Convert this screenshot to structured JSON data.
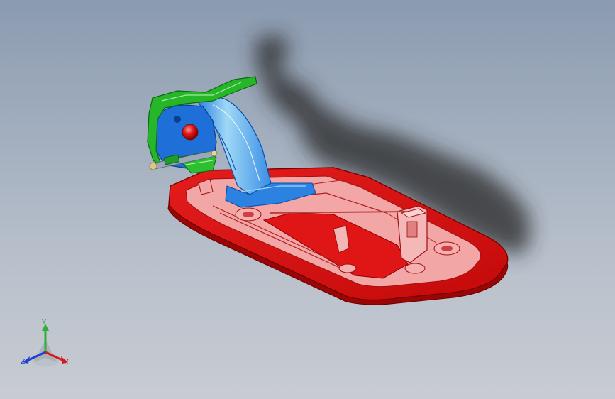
{
  "viewport": {
    "background_top": "#8b9bb0",
    "background_bottom": "#c8ccd2"
  },
  "model": {
    "colors": {
      "base_plate": "#e0141a",
      "base_plate_edge": "#8a0000",
      "base_highlight": "#f0a0a0",
      "bracket": "#7ec8f0",
      "bracket_dark": "#1e6fd8",
      "arm_frame": "#27b52a",
      "arm_frame_light": "#7be07b",
      "knob": "#d81818",
      "pin": "#d8c890",
      "shadow": "#2a2a2a"
    }
  },
  "triad": {
    "y_label": "Y",
    "x_label": "X",
    "z_label": "Z",
    "y_color": "#2fae3a",
    "x_color": "#d01c1c",
    "z_color": "#1e3fd0"
  }
}
